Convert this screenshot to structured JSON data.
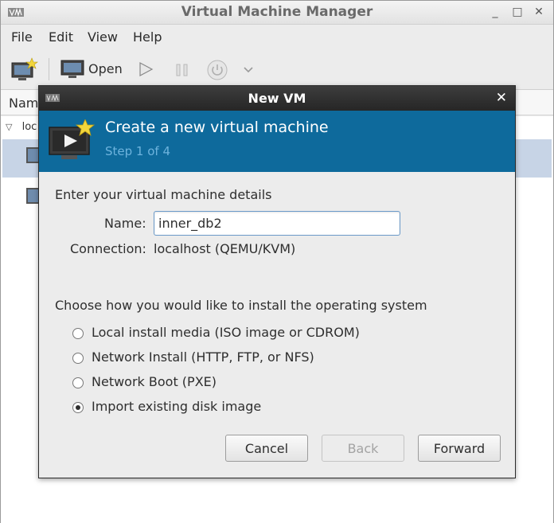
{
  "main_window": {
    "title": "Virtual Machine Manager",
    "menu": [
      "File",
      "Edit",
      "View",
      "Help"
    ],
    "toolbar": {
      "open_label": "Open"
    },
    "list_header": "Nam",
    "connection_row_label": "loc"
  },
  "dialog": {
    "title": "New VM",
    "banner": {
      "heading": "Create a new virtual machine",
      "step": "Step 1 of 4"
    },
    "details_title": "Enter your virtual machine details",
    "name_label": "Name:",
    "name_value": "inner_db2",
    "connection_label": "Connection:",
    "connection_value": "localhost (QEMU/KVM)",
    "install_title": "Choose how you would like to install the operating system",
    "install_options": [
      {
        "label": "Local install media (ISO image or CDROM)",
        "selected": false
      },
      {
        "label": "Network Install (HTTP, FTP, or NFS)",
        "selected": false
      },
      {
        "label": "Network Boot (PXE)",
        "selected": false
      },
      {
        "label": "Import existing disk image",
        "selected": true
      }
    ],
    "buttons": {
      "cancel": "Cancel",
      "back": "Back",
      "forward": "Forward"
    }
  },
  "colors": {
    "banner_bg": "#0e6a9c",
    "banner_step_text": "#6db3dd",
    "selection_bg": "#c7d4e6"
  }
}
